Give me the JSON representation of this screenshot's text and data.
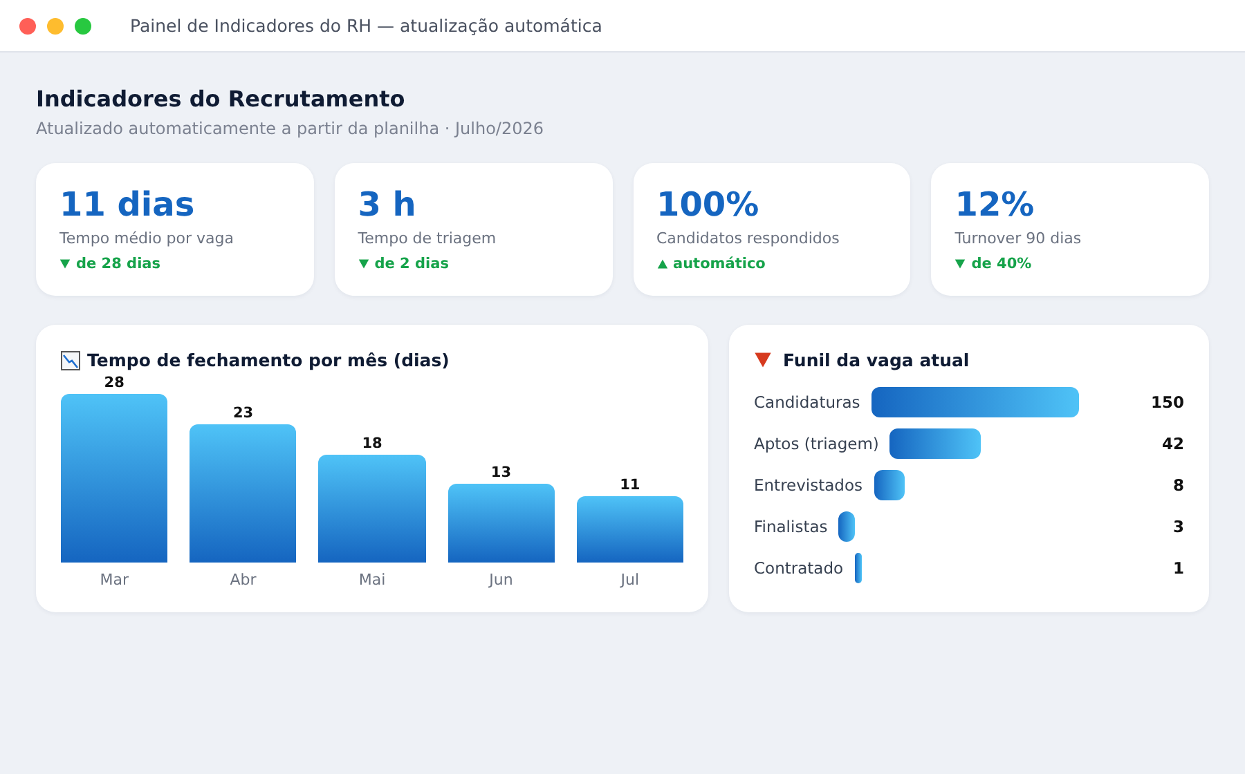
{
  "window": {
    "title": "Painel de Indicadores do RH — atualização automática"
  },
  "header": {
    "title": "Indicadores do Recrutamento",
    "subtitle": "Atualizado automaticamente a partir da planilha · Julho/2026"
  },
  "kpis": [
    {
      "value": "11 dias",
      "label": "Tempo médio por vaga",
      "kind": "down",
      "change": "de 28 dias"
    },
    {
      "value": "3 h",
      "label": "Tempo de triagem",
      "kind": "down",
      "change": "de 2 dias"
    },
    {
      "value": "100%",
      "label": "Candidatos respondidos",
      "kind": "up",
      "change": "automático"
    },
    {
      "value": "12%",
      "label": "Turnover 90 dias",
      "kind": "down",
      "change": "de 40%"
    }
  ],
  "closing_chart": {
    "title": "Tempo de fechamento por mês (dias)",
    "chart_data": {
      "type": "bar",
      "categories": [
        "Mar",
        "Abr",
        "Mai",
        "Jun",
        "Jul"
      ],
      "values": [
        28,
        23,
        18,
        13,
        11
      ],
      "data_labels": true
    }
  },
  "funnel": {
    "title": "Funil da vaga atual",
    "stages": [
      {
        "label": "Candidaturas",
        "count": "150"
      },
      {
        "label": "Aptos (triagem)",
        "count": "42"
      },
      {
        "label": "Entrevistados",
        "count": "8"
      },
      {
        "label": "Finalistas",
        "count": "3"
      },
      {
        "label": "Contratado",
        "count": "1"
      }
    ]
  }
}
